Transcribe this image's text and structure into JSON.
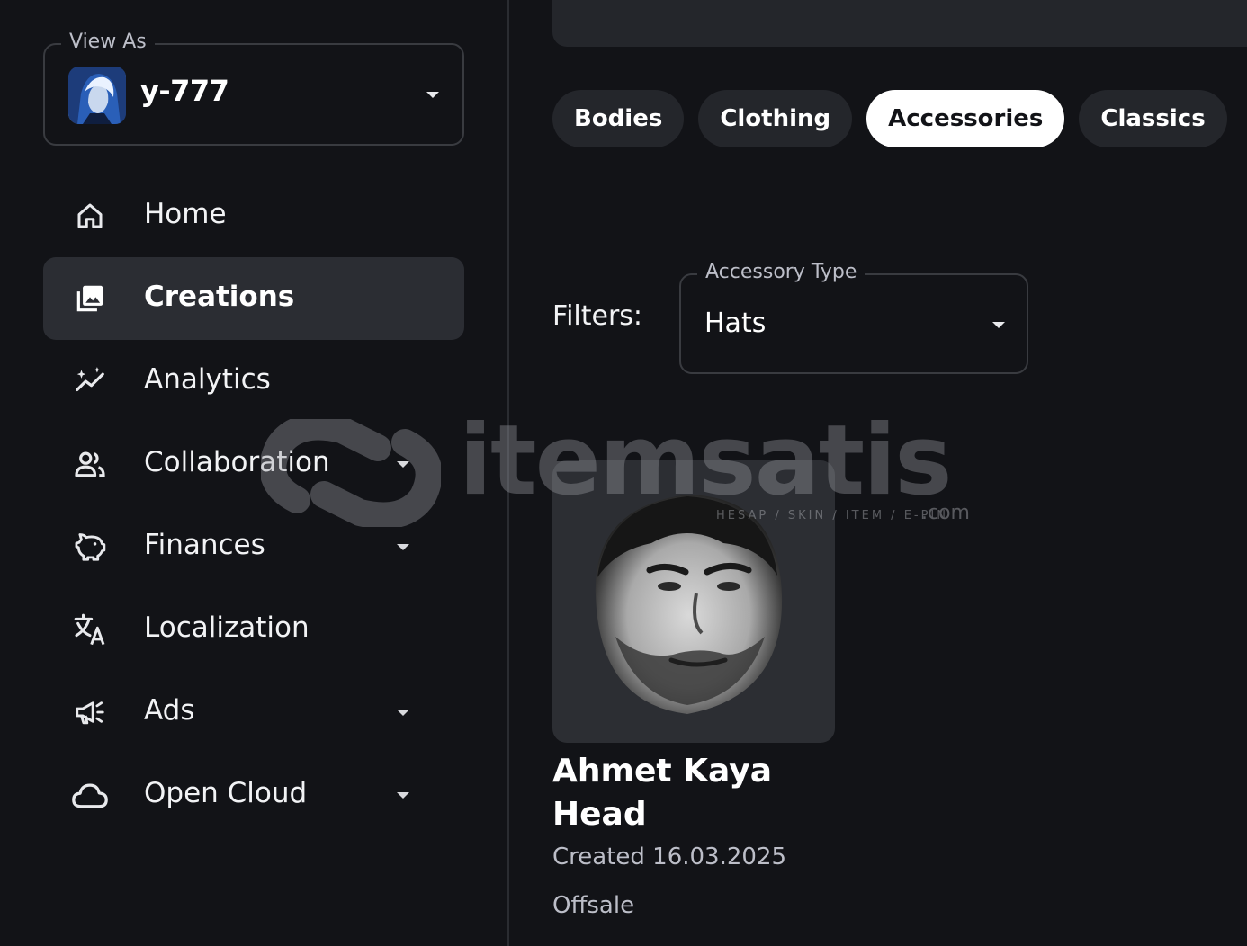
{
  "sidebar": {
    "view_as": {
      "legend": "View As",
      "name": "y-777"
    },
    "nav": [
      {
        "label": "Home",
        "icon": "home-icon",
        "active": false,
        "expandable": false
      },
      {
        "label": "Creations",
        "icon": "creations-icon",
        "active": true,
        "expandable": false
      },
      {
        "label": "Analytics",
        "icon": "analytics-icon",
        "active": false,
        "expandable": false
      },
      {
        "label": "Collaboration",
        "icon": "collaboration-icon",
        "active": false,
        "expandable": true
      },
      {
        "label": "Finances",
        "icon": "piggy-bank-icon",
        "active": false,
        "expandable": true
      },
      {
        "label": "Localization",
        "icon": "translate-icon",
        "active": false,
        "expandable": false
      },
      {
        "label": "Ads",
        "icon": "megaphone-icon",
        "active": false,
        "expandable": true
      },
      {
        "label": "Open Cloud",
        "icon": "cloud-icon",
        "active": false,
        "expandable": true
      }
    ]
  },
  "main": {
    "tabs": [
      {
        "label": "Bodies",
        "active": false
      },
      {
        "label": "Clothing",
        "active": false
      },
      {
        "label": "Accessories",
        "active": true
      },
      {
        "label": "Classics",
        "active": false
      }
    ],
    "filters_label": "Filters:",
    "accessory_type": {
      "legend": "Accessory Type",
      "value": "Hats"
    },
    "item": {
      "title": "Ahmet Kaya Head",
      "created": "Created 16.03.2025",
      "status": "Offsale"
    }
  },
  "watermark": {
    "brand": "itemsatis",
    "tagline": "HESAP / SKIN / ITEM / E-PIN",
    "suffix": ".com"
  },
  "colors": {
    "background": "#121317",
    "active_nav": "#2b2d33",
    "tab_bg": "#24262b",
    "tab_active_bg": "#ffffff"
  }
}
